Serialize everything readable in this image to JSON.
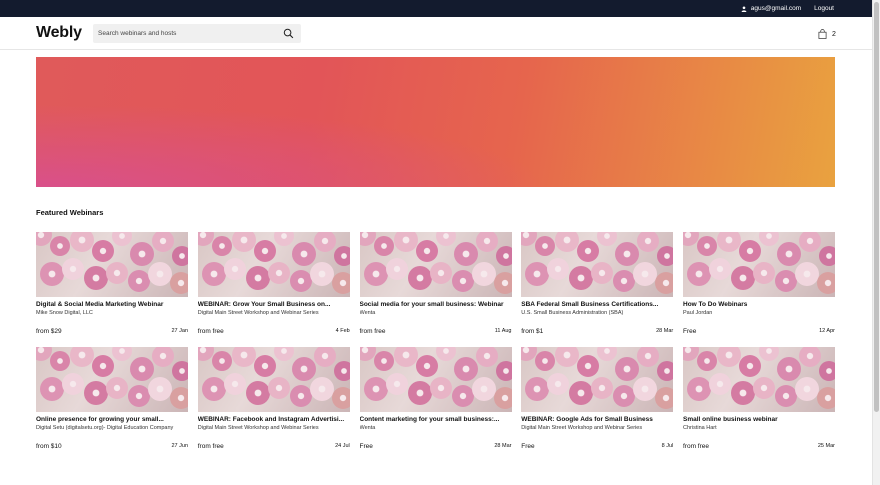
{
  "topbar": {
    "email": "agus@gmail.com",
    "logout": "Logout"
  },
  "header": {
    "logo": "Webly",
    "search_placeholder": "Search webinars and hosts",
    "cart_count": "2"
  },
  "colors": {
    "topbar": "#131b2e",
    "banner_start": "#d9508a",
    "banner_mid": "#e25558",
    "banner_end": "#e9a23f"
  },
  "featured": {
    "title": "Featured Webinars",
    "items": [
      {
        "title": "Digital & Social Media Marketing Webinar",
        "host": "Mike Snow Digital, LLC",
        "price": "from $29",
        "date": "27 Jan"
      },
      {
        "title": "WEBINAR: Grow Your Small Business on...",
        "host": "Digital Main Street Workshop and Webinar Series",
        "price": "from free",
        "date": "4 Feb"
      },
      {
        "title": "Social media for your small business: Webinar",
        "host": "Wenta",
        "price": "from free",
        "date": "11 Aug"
      },
      {
        "title": "SBA Federal Small Business Certifications...",
        "host": "U.S. Small Business Administration (SBA)",
        "price": "from $1",
        "date": "28 Mar"
      },
      {
        "title": "How To Do Webinars",
        "host": "Paul Jordan",
        "price": "Free",
        "date": "12 Apr"
      },
      {
        "title": "Online presence for growing your small...",
        "host": "Digital Setu (digitalsetu.org)- Digital Education Company",
        "price": "from $10",
        "date": "27 Jun"
      },
      {
        "title": "WEBINAR: Facebook and Instagram Advertisi...",
        "host": "Digital Main Street Workshop and Webinar Series",
        "price": "from free",
        "date": "24 Jul"
      },
      {
        "title": "Content marketing for your small business:...",
        "host": "Wenta",
        "price": "Free",
        "date": "28 Mar"
      },
      {
        "title": "WEBINAR: Google Ads for Small Business",
        "host": "Digital Main Street Workshop and Webinar Series",
        "price": "Free",
        "date": "8 Jul"
      },
      {
        "title": "Small online business webinar",
        "host": "Christina Hart",
        "price": "from free",
        "date": "25 Mar"
      }
    ]
  }
}
